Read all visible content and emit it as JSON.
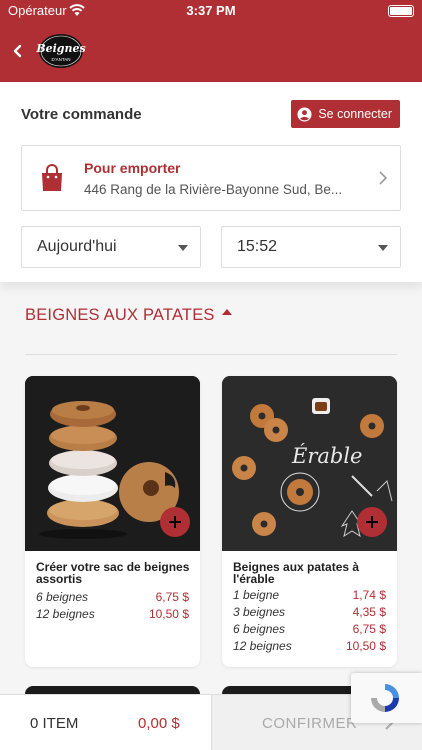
{
  "status_bar": {
    "carrier": "Opérateur",
    "time": "3:37 PM"
  },
  "header": {
    "logo_text": "Beignes",
    "logo_subtext": "D'ANTAN",
    "back_icon": "chevron-left-icon"
  },
  "order": {
    "title": "Votre commande",
    "login_label": "Se connecter",
    "pickup_title": "Pour emporter",
    "pickup_address": "446 Rang de la Rivière-Bayonne Sud, Be...",
    "day_value": "Aujourd'hui",
    "time_value": "15:52"
  },
  "section": {
    "title": "BEIGNES AUX PATATES"
  },
  "products": [
    {
      "name": "Créer votre sac de beignes assortis",
      "rows": [
        {
          "qty": "6 beignes",
          "price": "6,75 $"
        },
        {
          "qty": "12 beignes",
          "price": "10,50 $"
        }
      ]
    },
    {
      "name": "Beignes aux patates à l'érable",
      "image_text": "Érable",
      "rows": [
        {
          "qty": "1 beigne",
          "price": "1,74 $"
        },
        {
          "qty": "3 beignes",
          "price": "4,35 $"
        },
        {
          "qty": "6 beignes",
          "price": "6,75 $"
        },
        {
          "qty": "12 beignes",
          "price": "10,50 $"
        }
      ]
    }
  ],
  "cart": {
    "count_label": "0 ITEM",
    "total": "0,00 $",
    "confirm_label": "CONFIRMER"
  },
  "colors": {
    "brand": "#b02f34"
  }
}
